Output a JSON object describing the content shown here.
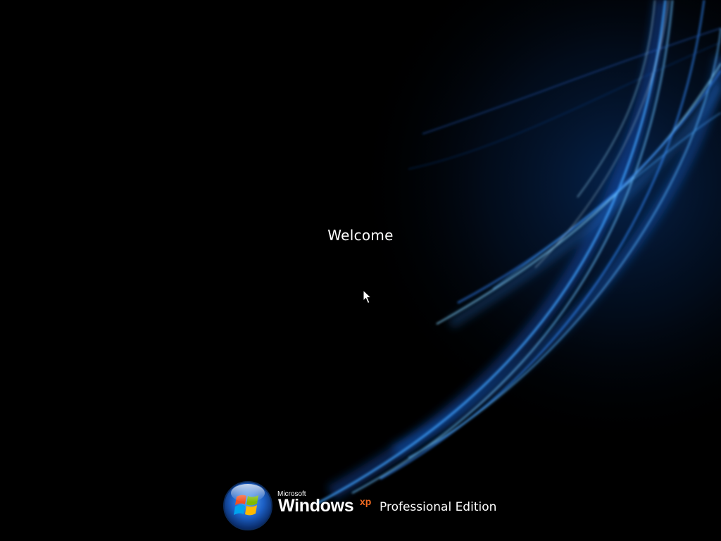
{
  "screen": {
    "welcome_text": "Welcome",
    "background_color": "#000000",
    "accent_color": "#2a8cff"
  },
  "branding": {
    "company": "Microsoft",
    "product": "Windows",
    "version": "xp",
    "edition": "Professional Edition",
    "logo_icon": "windows-flag-icon",
    "xp_color": "#f26a21"
  },
  "cursor": {
    "icon": "arrow-cursor-icon"
  }
}
